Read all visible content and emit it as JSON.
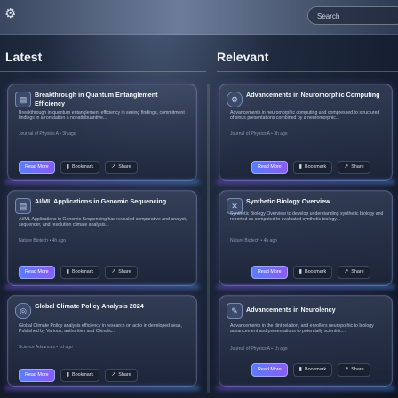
{
  "header": {
    "settings_icon": "gear-icon",
    "search_placeholder": "Search"
  },
  "columns": {
    "latest_title": "Latest",
    "relevant_title": "Relevant"
  },
  "actions": {
    "read_more": "Read More",
    "bookmark": "Bookmark",
    "share": "Share"
  },
  "latest": [
    {
      "title": "Breakthrough in Quantum Entanglement Efficiency",
      "summary": "Breakthrough in quantum entanglement efficiency in seeing findings, commitment findings in a ronutation a nonattribuantive...",
      "source": "Journal of Physics A • 3h ago",
      "icon": "document-icon"
    },
    {
      "title": "AI/ML Applications in Genomic Sequencing",
      "summary": "AI/ML Applications in Genomic Sequencing has revealed comparative and analyst, sequencer, and resolution climate analysis...",
      "source": "Nature Biotech • 4h ago",
      "icon": "document-icon"
    },
    {
      "title": "Global Climate Policy Analysis 2024",
      "summary": "Global Climate Policy analysis efficiency in research on actio in developed seas, Published by Various, authorities and Climatic...",
      "source": "Science Advances • 1d ago",
      "icon": "globe-icon"
    }
  ],
  "relevant": [
    {
      "title": "Advancements in Neuromorphic Computing",
      "summary": "Advancements in neuromorphic computing and compressed to structured of sinus presentations combined by a neuromorphic...",
      "source": "Journal of Physics A • 3h ago",
      "icon": "chip-icon"
    },
    {
      "title": "Synthetic Biology Overview",
      "summary": "Synthetic Biology Overview to develop understanding synthetic biology and reported as computed to evaluated synthetic biology...",
      "source": "Nature Biotech • 4h ago",
      "icon": "dna-icon"
    },
    {
      "title": "Advancements in Neurolency",
      "summary": "Advancements in the dint relation, and enrollers neuropothic to biology advancement and presentations to potentially scientific...",
      "source": "Journal of Physics A • 1h ago",
      "icon": "pen-icon"
    }
  ]
}
